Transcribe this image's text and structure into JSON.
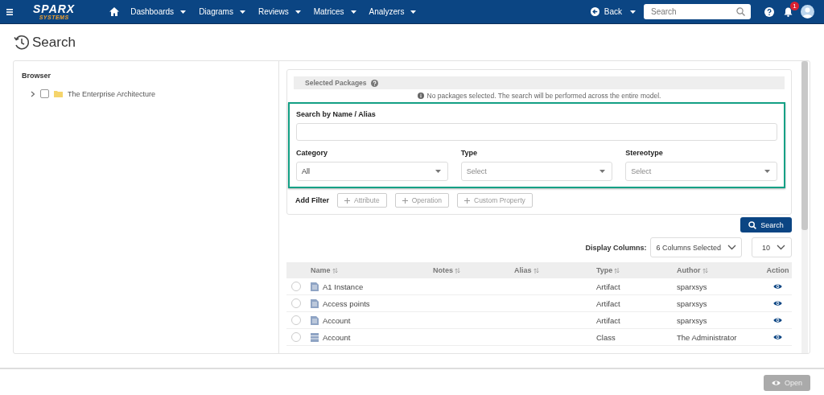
{
  "navbar": {
    "logo": {
      "name": "SPARX",
      "tagline": "SYSTEMS"
    },
    "menu": [
      {
        "label": "Dashboards"
      },
      {
        "label": "Diagrams"
      },
      {
        "label": "Reviews"
      },
      {
        "label": "Matrices"
      },
      {
        "label": "Analyzers"
      }
    ],
    "back": "Back",
    "search": {
      "placeholder": "Search"
    },
    "notification_count": "1"
  },
  "page_title": "Search",
  "browser": {
    "title": "Browser",
    "tree": [
      {
        "label": "The Enterprise Architecture",
        "expanded": false,
        "checked": false
      }
    ]
  },
  "selected_packages": {
    "title": "Selected Packages",
    "message": "No packages selected. The search will be performed across the entire model."
  },
  "search_form": {
    "name_label": "Search by Name / Alias",
    "selects": [
      {
        "label": "Category",
        "value": "All"
      },
      {
        "label": "Type",
        "placeholder": "Select"
      },
      {
        "label": "Stereotype",
        "placeholder": "Select"
      }
    ]
  },
  "add_filter": {
    "label": "Add Filter",
    "buttons": [
      "Attribute",
      "Operation",
      "Custom Property"
    ]
  },
  "search_button": "Search",
  "display_columns": {
    "label": "Display Columns:",
    "value": "6 Columns Selected",
    "page_size": "10"
  },
  "table": {
    "columns": [
      {
        "label": "Name",
        "sortable": true
      },
      {
        "label": "Notes",
        "sortable": true
      },
      {
        "label": "Alias",
        "sortable": true
      },
      {
        "label": "Type",
        "sortable": true
      },
      {
        "label": "Author",
        "sortable": true
      },
      {
        "label": "Action",
        "sortable": false
      }
    ],
    "rows": [
      {
        "selected": false,
        "kind": "artifact",
        "name": "A1 Instance",
        "type": "Artifact",
        "author": "sparxsys"
      },
      {
        "selected": false,
        "kind": "artifact",
        "name": "Access points",
        "type": "Artifact",
        "author": "sparxsys"
      },
      {
        "selected": false,
        "kind": "artifact",
        "name": "Account",
        "type": "Artifact",
        "author": "sparxsys"
      },
      {
        "selected": false,
        "kind": "class",
        "name": "Account",
        "type": "Class",
        "author": "The Administrator"
      }
    ]
  },
  "open_button": {
    "label": "Open",
    "disabled": true
  }
}
